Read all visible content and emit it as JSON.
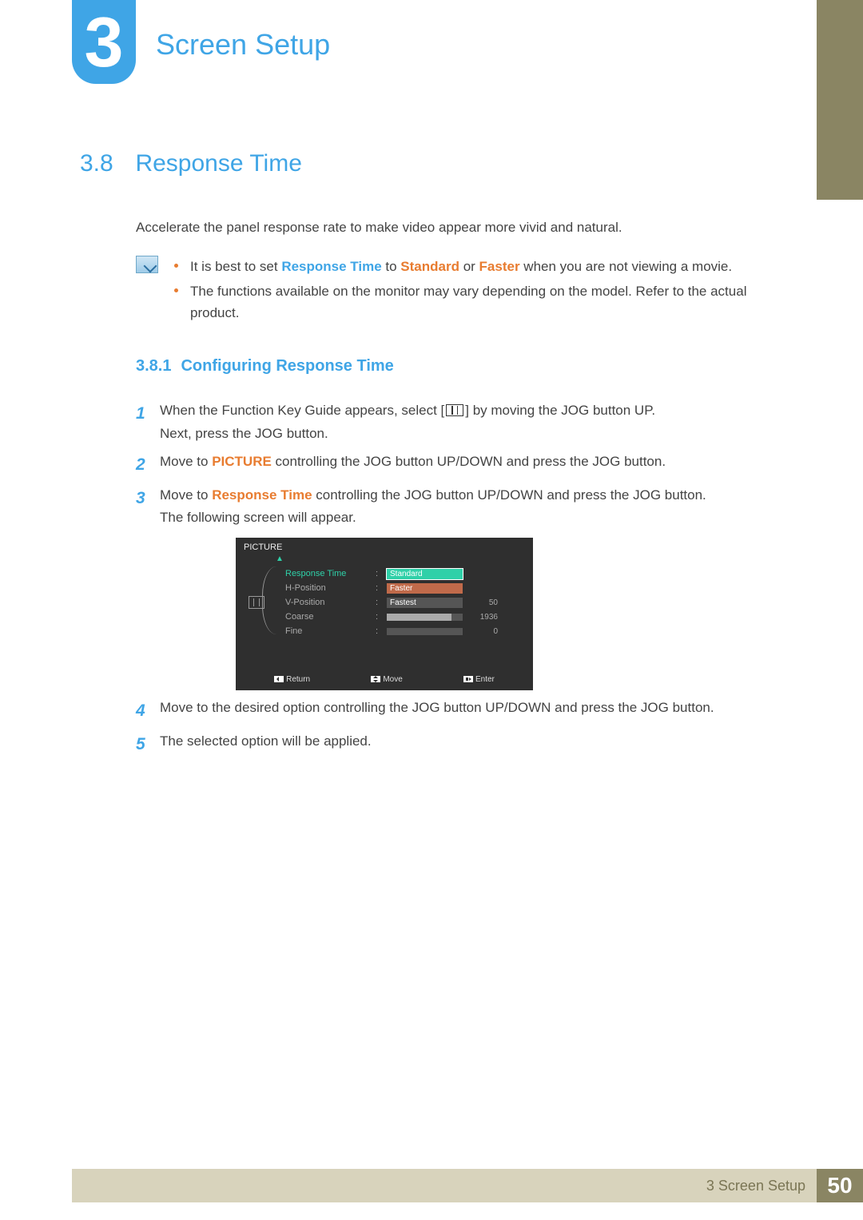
{
  "chapter": {
    "number": "3",
    "title": "Screen Setup"
  },
  "section": {
    "number": "3.8",
    "title": "Response Time"
  },
  "intro": "Accelerate the panel response rate to make video appear more vivid and natural.",
  "notes": {
    "n1": {
      "pre": "It is best to set ",
      "term1": "Response Time",
      "mid1": " to ",
      "term2": "Standard",
      "mid2": " or ",
      "term3": "Faster",
      "post": " when you are not viewing a movie."
    },
    "n2": "The functions available on the monitor may vary depending on the model. Refer to the actual product."
  },
  "subsection": {
    "number": "3.8.1",
    "title": "Configuring Response Time"
  },
  "steps": {
    "s1a": "When the Function Key Guide appears, select [",
    "s1b": "] by moving the JOG button UP.",
    "s1c": "Next, press the JOG button.",
    "s2a": "Move to ",
    "s2term": "PICTURE",
    "s2b": " controlling the JOG button UP/DOWN and press the JOG button.",
    "s3a": "Move to  ",
    "s3term": "Response Time",
    "s3b": " controlling the JOG button UP/DOWN and press the JOG button.",
    "s3c": "The following screen will appear.",
    "s4": "Move to the desired option controlling the JOG button UP/DOWN and press the JOG button.",
    "s5": "The selected option will be applied."
  },
  "stepnums": {
    "n1": "1",
    "n2": "2",
    "n3": "3",
    "n4": "4",
    "n5": "5"
  },
  "osd": {
    "header": "PICTURE",
    "up": "▲",
    "items": {
      "response": "Response Time",
      "hpos": "H-Position",
      "vpos": "V-Position",
      "coarse": "Coarse",
      "fine": "Fine"
    },
    "options": {
      "standard": "Standard",
      "faster": "Faster",
      "fastest": "Fastest"
    },
    "values": {
      "hpos": "50",
      "coarse": "1936",
      "fine": "0"
    },
    "footer": {
      "return": "Return",
      "move": "Move",
      "enter": "Enter"
    }
  },
  "footer": {
    "label": "3 Screen Setup",
    "page": "50"
  }
}
